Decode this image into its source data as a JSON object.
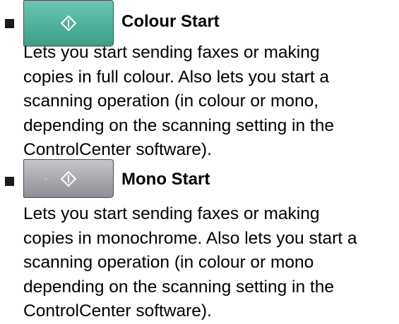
{
  "items": [
    {
      "key_icon": "start-diamond-icon",
      "key_color": "#4fb19c",
      "title": "Colour Start",
      "description_lines": [
        "Lets you start sending faxes or making",
        "copies in full colour. Also lets you start a",
        "scanning operation (in colour or mono,",
        "depending on the scanning setting in the",
        "ControlCenter software)."
      ]
    },
    {
      "key_icon": "start-diamond-icon",
      "key_color": "#a4a4aa",
      "title": "Mono Start",
      "description_lines": [
        "Lets you start sending faxes or making",
        "copies in monochrome. Also lets you start a",
        "scanning operation (in colour or mono",
        "depending on the scanning setting in the",
        "ControlCenter software)."
      ]
    }
  ]
}
